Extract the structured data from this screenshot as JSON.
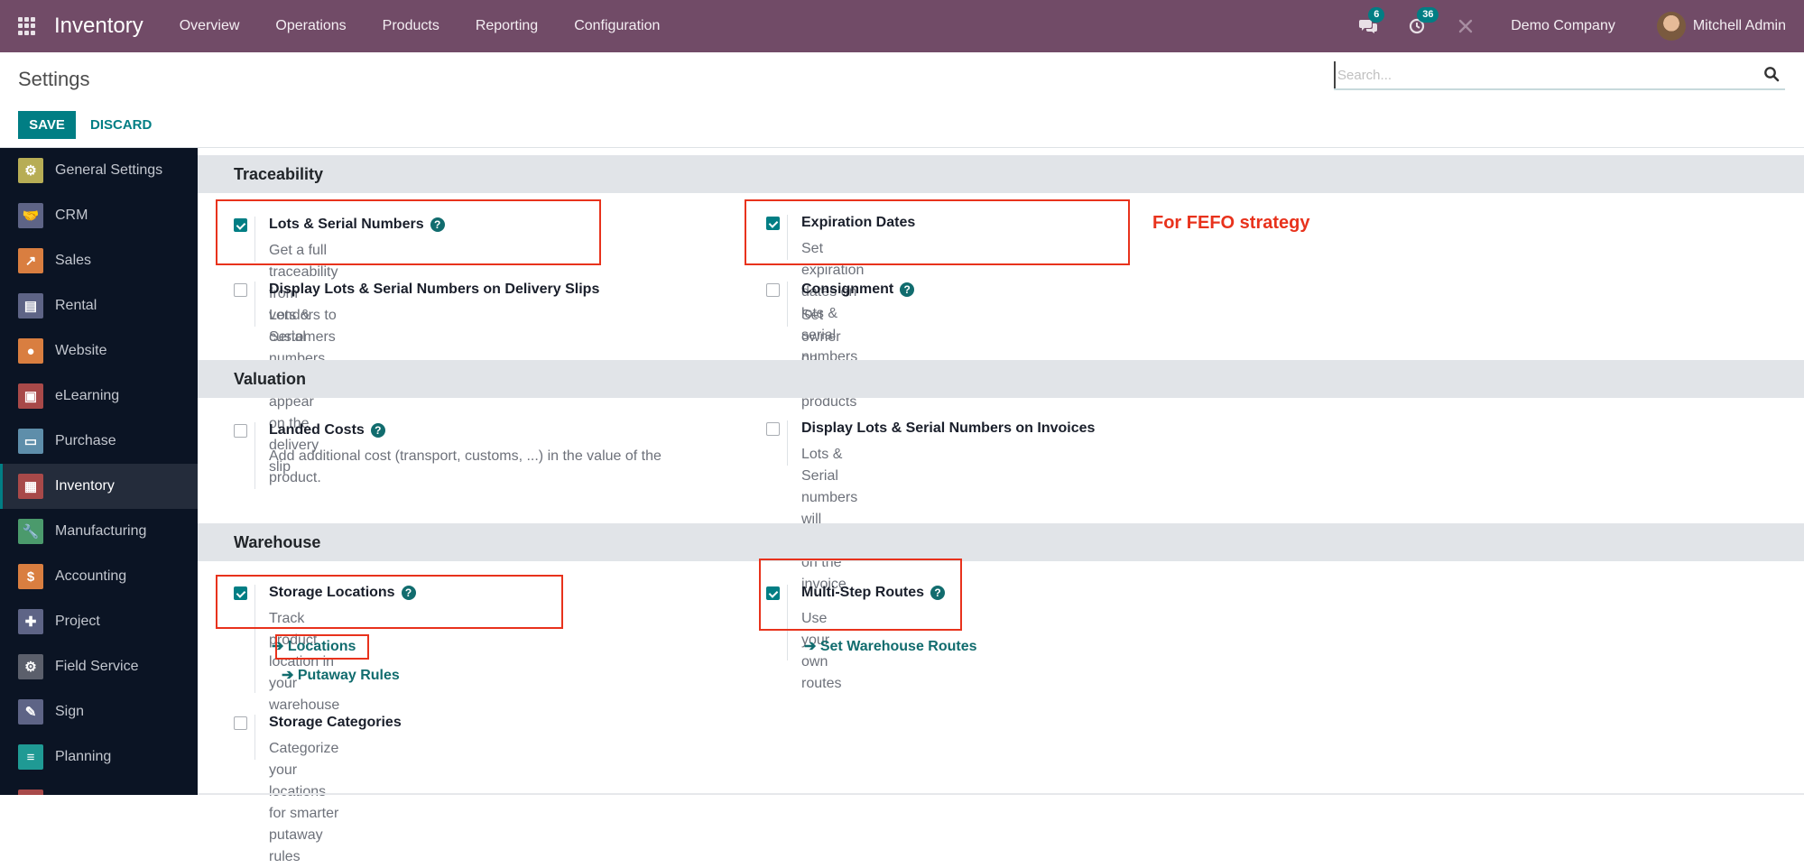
{
  "navbar": {
    "app_name": "Inventory",
    "menu": [
      "Overview",
      "Operations",
      "Products",
      "Reporting",
      "Configuration"
    ],
    "messages_count": "6",
    "activities_count": "36",
    "company": "Demo Company",
    "user": "Mitchell Admin",
    "icons": {
      "apps": "apps-grid-icon",
      "messages": "chat-bubbles-icon",
      "activities": "clock-icon",
      "debug": "tools-icon"
    }
  },
  "control": {
    "title": "Settings",
    "save_label": "SAVE",
    "discard_label": "DISCARD",
    "search_placeholder": "Search...",
    "search_value": ""
  },
  "sidebar": {
    "items": [
      {
        "label": "General Settings",
        "icon": "gear-icon",
        "color": "#b7ad55",
        "glyph": "⚙"
      },
      {
        "label": "CRM",
        "icon": "handshake-icon",
        "color": "#5e6486",
        "glyph": "🤝"
      },
      {
        "label": "Sales",
        "icon": "chart-up-icon",
        "color": "#d97e40",
        "glyph": "↗"
      },
      {
        "label": "Rental",
        "icon": "calendar-icon",
        "color": "#5e6486",
        "glyph": "▤"
      },
      {
        "label": "Website",
        "icon": "globe-icon",
        "color": "#d97e40",
        "glyph": "●"
      },
      {
        "label": "eLearning",
        "icon": "presentation-icon",
        "color": "#a84949",
        "glyph": "▣"
      },
      {
        "label": "Purchase",
        "icon": "credit-card-icon",
        "color": "#5e8eaa",
        "glyph": "▭"
      },
      {
        "label": "Inventory",
        "icon": "box-icon",
        "color": "#a84949",
        "glyph": "▦",
        "active": true
      },
      {
        "label": "Manufacturing",
        "icon": "wrench-icon",
        "color": "#4b9a6c",
        "glyph": "🔧"
      },
      {
        "label": "Accounting",
        "icon": "invoice-icon",
        "color": "#d97e40",
        "glyph": "$"
      },
      {
        "label": "Project",
        "icon": "puzzle-icon",
        "color": "#5e6486",
        "glyph": "✚"
      },
      {
        "label": "Field Service",
        "icon": "field-service-icon",
        "color": "#5b5f6b",
        "glyph": "⚙"
      },
      {
        "label": "Sign",
        "icon": "sign-icon",
        "color": "#5e6486",
        "glyph": "✎"
      },
      {
        "label": "Planning",
        "icon": "planning-icon",
        "color": "#1f9a94",
        "glyph": "≡"
      },
      {
        "label": "",
        "icon": "app-icon",
        "color": "#a84949",
        "glyph": ""
      }
    ]
  },
  "sections": {
    "traceability": {
      "title": "Traceability",
      "lots": {
        "title": "Lots & Serial Numbers",
        "desc": "Get a full traceability from vendors to customers",
        "checked": true,
        "help": "?"
      },
      "delivery_slips": {
        "title": "Display Lots & Serial Numbers on Delivery Slips",
        "desc": "Lots & Serial numbers will appear on the delivery slip",
        "checked": false
      },
      "expiration": {
        "title": "Expiration Dates",
        "desc": "Set expiration dates on lots & serial numbers",
        "checked": true
      },
      "consignment": {
        "title": "Consignment",
        "desc": "Set owner on stored products",
        "checked": false,
        "help": "?"
      }
    },
    "valuation": {
      "title": "Valuation",
      "landed_costs": {
        "title": "Landed Costs",
        "desc": "Add additional cost (transport, customs, ...) in the value of the product.",
        "checked": false,
        "help": "?"
      },
      "invoices": {
        "title": "Display Lots & Serial Numbers on Invoices",
        "desc": "Lots & Serial numbers will appear on the invoice",
        "checked": false
      }
    },
    "warehouse": {
      "title": "Warehouse",
      "storage_locations": {
        "title": "Storage Locations",
        "desc": "Track product location in your warehouse",
        "checked": true,
        "help": "?",
        "links": [
          "Locations",
          "Putaway Rules"
        ]
      },
      "multi_step": {
        "title": "Multi-Step Routes",
        "desc": "Use your own routes",
        "checked": true,
        "help": "?",
        "links": [
          "Set Warehouse Routes"
        ]
      },
      "storage_categories": {
        "title": "Storage Categories",
        "desc": "Categorize your locations for smarter putaway rules",
        "checked": false
      }
    }
  },
  "annotations": {
    "fefo_note": "For FEFO strategy",
    "highlight_color": "#e8321c"
  },
  "colors": {
    "navbar": "#714b67",
    "primary": "#017e84",
    "link": "#116c6e",
    "sidebar": "#0b1424"
  },
  "link_arrow": "➔"
}
